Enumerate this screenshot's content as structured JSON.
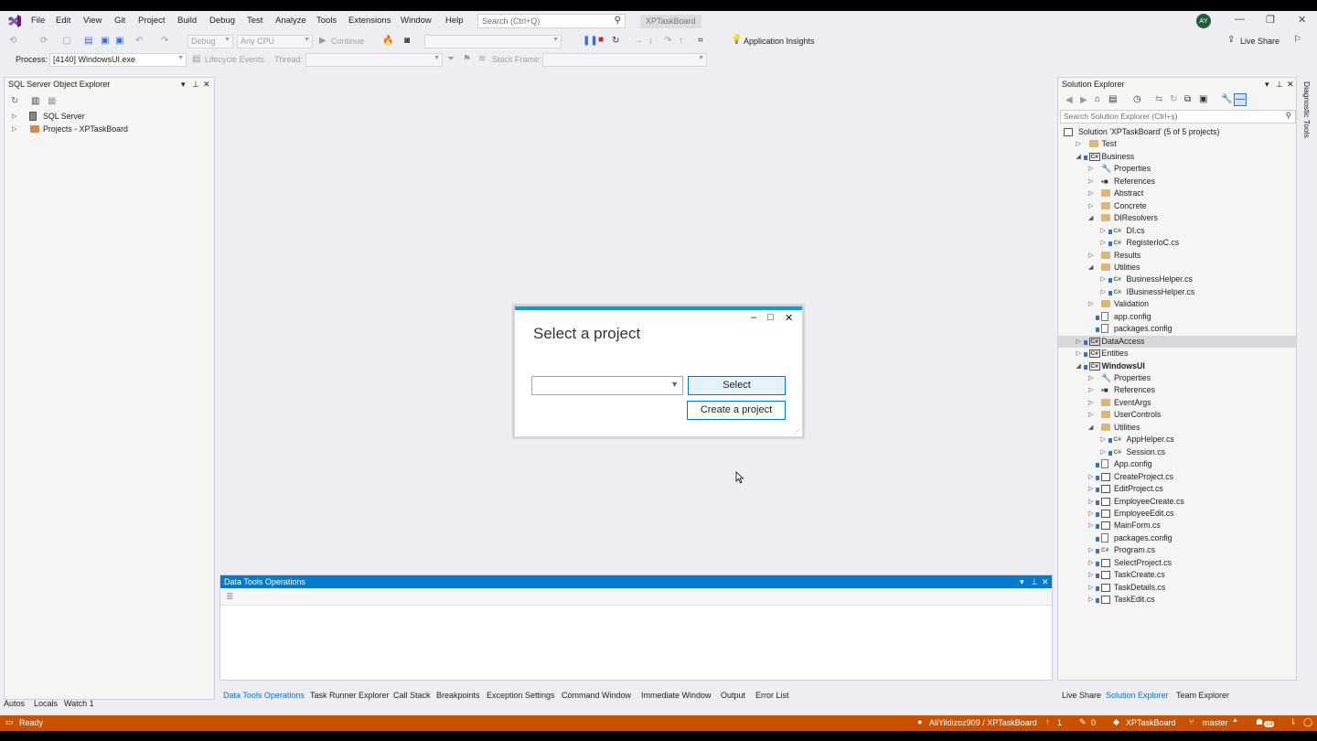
{
  "menu": {
    "items": [
      "File",
      "Edit",
      "View",
      "Git",
      "Project",
      "Build",
      "Debug",
      "Test",
      "Analyze",
      "Tools",
      "Extensions",
      "Window",
      "Help"
    ],
    "search_placeholder": "Search (Ctrl+Q)",
    "solution_name": "XPTaskBoard",
    "avatar_initials": "AY"
  },
  "toolbar": {
    "config": "Debug",
    "platform": "Any CPU",
    "continue_label": "Continue",
    "app_insights": "Application Insights",
    "live_share": "Live Share",
    "process_label": "Process:",
    "process_value": "[4140] WindowsUI.exe",
    "lifecycle_label": "Lifecycle Events",
    "thread_label": "Thread:",
    "stack_frame_label": "Stack Frame:"
  },
  "sql_explorer": {
    "title": "SQL Server Object Explorer",
    "items": [
      "SQL Server",
      "Projects - XPTaskBoard"
    ]
  },
  "solution_explorer": {
    "title": "Solution Explorer",
    "search_placeholder": "Search Solution Explorer (Ctrl+ş)",
    "items": [
      {
        "label": "Solution 'XPTaskBoard' (5 of 5 projects)",
        "depth": 0,
        "arrow": "",
        "icon": "solution",
        "bold": false
      },
      {
        "label": "Test",
        "depth": 1,
        "arrow": "▷",
        "icon": "folder",
        "bold": false
      },
      {
        "label": "Business",
        "depth": 1,
        "arrow": "◢",
        "icon": "proj",
        "bold": false
      },
      {
        "label": "Properties",
        "depth": 2,
        "arrow": "▷",
        "icon": "wrench",
        "bold": false
      },
      {
        "label": "References",
        "depth": 2,
        "arrow": "▷",
        "icon": "ref",
        "bold": false
      },
      {
        "label": "Abstract",
        "depth": 2,
        "arrow": "▷",
        "icon": "folder",
        "bold": false
      },
      {
        "label": "Concrete",
        "depth": 2,
        "arrow": "▷",
        "icon": "folder",
        "bold": false
      },
      {
        "label": "DIResolvers",
        "depth": 2,
        "arrow": "◢",
        "icon": "folder",
        "bold": false
      },
      {
        "label": "DI.cs",
        "depth": 3,
        "arrow": "▷",
        "icon": "cs",
        "bold": false
      },
      {
        "label": "RegisterIoC.cs",
        "depth": 3,
        "arrow": "▷",
        "icon": "cs",
        "bold": false
      },
      {
        "label": "Results",
        "depth": 2,
        "arrow": "▷",
        "icon": "folder",
        "bold": false
      },
      {
        "label": "Utilities",
        "depth": 2,
        "arrow": "◢",
        "icon": "folder",
        "bold": false
      },
      {
        "label": "BusinessHelper.cs",
        "depth": 3,
        "arrow": "▷",
        "icon": "cs",
        "bold": false
      },
      {
        "label": "IBusinessHelper.cs",
        "depth": 3,
        "arrow": "▷",
        "icon": "cs",
        "bold": false
      },
      {
        "label": "Validation",
        "depth": 2,
        "arrow": "▷",
        "icon": "folder",
        "bold": false
      },
      {
        "label": "app.config",
        "depth": 2,
        "arrow": "",
        "icon": "file",
        "bold": false
      },
      {
        "label": "packages.config",
        "depth": 2,
        "arrow": "",
        "icon": "file",
        "bold": false
      },
      {
        "label": "DataAccess",
        "depth": 1,
        "arrow": "▷",
        "icon": "proj",
        "bold": false,
        "selected": true
      },
      {
        "label": "Entities",
        "depth": 1,
        "arrow": "▷",
        "icon": "proj",
        "bold": false
      },
      {
        "label": "WindowsUI",
        "depth": 1,
        "arrow": "◢",
        "icon": "proj",
        "bold": true
      },
      {
        "label": "Properties",
        "depth": 2,
        "arrow": "▷",
        "icon": "wrench",
        "bold": false
      },
      {
        "label": "References",
        "depth": 2,
        "arrow": "▷",
        "icon": "ref",
        "bold": false
      },
      {
        "label": "EventArgs",
        "depth": 2,
        "arrow": "▷",
        "icon": "folder",
        "bold": false
      },
      {
        "label": "UserControls",
        "depth": 2,
        "arrow": "▷",
        "icon": "folder",
        "bold": false
      },
      {
        "label": "Utilities",
        "depth": 2,
        "arrow": "◢",
        "icon": "folder",
        "bold": false
      },
      {
        "label": "AppHelper.cs",
        "depth": 3,
        "arrow": "▷",
        "icon": "cs",
        "bold": false
      },
      {
        "label": "Session.cs",
        "depth": 3,
        "arrow": "▷",
        "icon": "cs",
        "bold": false
      },
      {
        "label": "App.config",
        "depth": 2,
        "arrow": "",
        "icon": "file",
        "bold": false
      },
      {
        "label": "CreateProject.cs",
        "depth": 2,
        "arrow": "▷",
        "icon": "form",
        "bold": false
      },
      {
        "label": "EditProject.cs",
        "depth": 2,
        "arrow": "▷",
        "icon": "form",
        "bold": false
      },
      {
        "label": "EmployeeCreate.cs",
        "depth": 2,
        "arrow": "▷",
        "icon": "form",
        "bold": false
      },
      {
        "label": "EmployeeEdit.cs",
        "depth": 2,
        "arrow": "▷",
        "icon": "form",
        "bold": false
      },
      {
        "label": "MainForm.cs",
        "depth": 2,
        "arrow": "▷",
        "icon": "form",
        "bold": false
      },
      {
        "label": "packages.config",
        "depth": 2,
        "arrow": "",
        "icon": "file",
        "bold": false
      },
      {
        "label": "Program.cs",
        "depth": 2,
        "arrow": "▷",
        "icon": "cs",
        "bold": false
      },
      {
        "label": "SelectProject.cs",
        "depth": 2,
        "arrow": "▷",
        "icon": "form",
        "bold": false
      },
      {
        "label": "TaskCreate.cs",
        "depth": 2,
        "arrow": "▷",
        "icon": "form",
        "bold": false
      },
      {
        "label": "TaskDetails.cs",
        "depth": 2,
        "arrow": "▷",
        "icon": "form",
        "bold": false
      },
      {
        "label": "TaskEdit.cs",
        "depth": 2,
        "arrow": "▷",
        "icon": "form",
        "bold": false
      }
    ],
    "bottom_tabs": [
      "Live Share",
      "Solution Explorer",
      "Team Explorer"
    ],
    "side_tab": "Diagnostic Tools"
  },
  "data_tools": {
    "title": "Data Tools Operations"
  },
  "bottom_tabs": [
    "Data Tools Operations",
    "Task Runner Explorer",
    "Call Stack",
    "Breakpoints",
    "Exception Settings",
    "Command Window",
    "Immediate Window",
    "Output",
    "Error List"
  ],
  "left_bottom_tabs": [
    "Autos",
    "Locals",
    "Watch 1"
  ],
  "dialog": {
    "title": "Select a project",
    "select_button": "Select",
    "create_button": "Create a project"
  },
  "statusbar": {
    "ready": "Ready",
    "repo": "AliYildizoz909 / XPTaskBoard",
    "up_count": "1",
    "pending": "0",
    "solution": "XPTaskBoard",
    "branch": "master",
    "notif_count": "19"
  },
  "colors": {
    "accent": "#007acc",
    "status_bar": "#ca5100",
    "dialog_bar": "#0f9ad8"
  }
}
